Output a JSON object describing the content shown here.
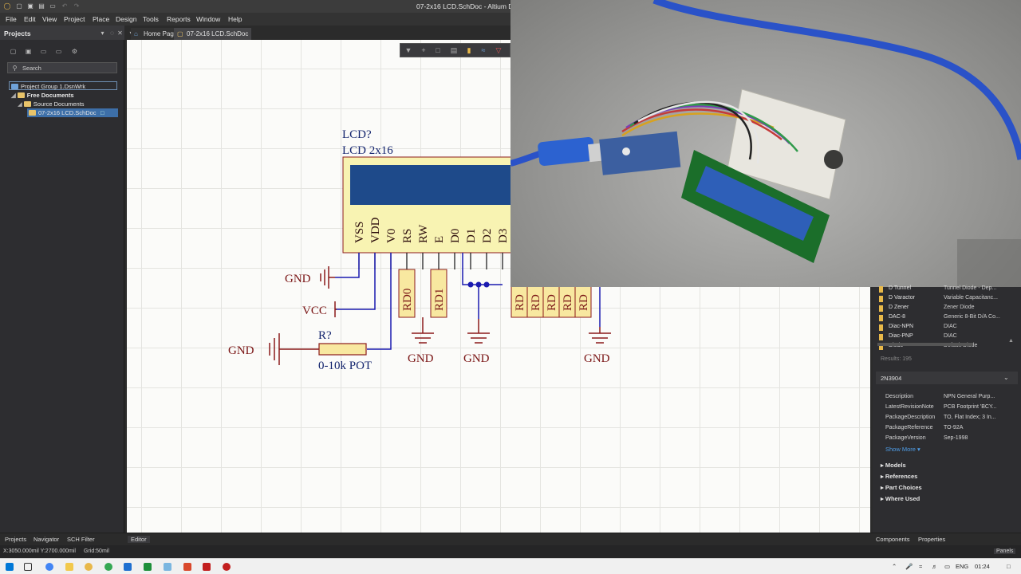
{
  "window": {
    "title": "07-2x16 LCD.SchDoc - Altium Des",
    "min_icon": "minimize-icon"
  },
  "menu": [
    "File",
    "Edit",
    "View",
    "Project",
    "Place",
    "Design",
    "Tools",
    "Reports",
    "Window",
    "Help"
  ],
  "projects_panel": {
    "title": "Projects",
    "search_placeholder": "Search",
    "tree": [
      {
        "label": "Project Group 1.DsnWrk",
        "level": 0
      },
      {
        "label": "Free Documents",
        "level": 1
      },
      {
        "label": "Source Documents",
        "level": 2
      },
      {
        "label": "07-2x16 LCD.SchDoc",
        "level": 3
      }
    ]
  },
  "tabs": [
    {
      "label": "Home Page"
    },
    {
      "label": "07-2x16 LCD.SchDoc"
    }
  ],
  "schematic": {
    "designator": "LCD?",
    "part": "LCD 2x16",
    "pins": [
      "VSS",
      "VDD",
      "V0",
      "RS",
      "RW",
      "E",
      "D0",
      "D1",
      "D2",
      "D3"
    ],
    "resistors_left": [
      "RD0",
      "RD1"
    ],
    "resistors_right": [
      "RD",
      "RD",
      "RD",
      "RD",
      "RD"
    ],
    "gnd_label": "GND",
    "vcc_label": "VCC",
    "pot_designator": "R?",
    "pot_value": "0-10k POT"
  },
  "components_list": [
    {
      "name": "D Tunnel",
      "desc": "Tunnel Diode - Dep..."
    },
    {
      "name": "D Varactor",
      "desc": "Variable Capacitanc..."
    },
    {
      "name": "D Zener",
      "desc": "Zener Diode"
    },
    {
      "name": "DAC-8",
      "desc": "Generic 8-Bit D/A Co..."
    },
    {
      "name": "Diac-NPN",
      "desc": "DIAC"
    },
    {
      "name": "Diac-PNP",
      "desc": "DIAC"
    },
    {
      "name": "Diode",
      "desc": "Default Diode"
    }
  ],
  "results": "Results: 195",
  "selected_component": {
    "name": "2N3904",
    "properties": [
      {
        "k": "Description",
        "v": "NPN General Purp..."
      },
      {
        "k": "LatestRevisionNote",
        "v": "PCB Footprint 'BCY..."
      },
      {
        "k": "PackageDescription",
        "v": "TO, Flat Index; 3 In..."
      },
      {
        "k": "PackageReference",
        "v": "TO-92A"
      },
      {
        "k": "PackageVersion",
        "v": "Sep-1998"
      }
    ],
    "show_more": "Show More ▾",
    "sections": [
      "Models",
      "References",
      "Part Choices",
      "Where Used"
    ]
  },
  "bottom_tabs": {
    "left": [
      "Projects",
      "Navigator",
      "SCH Filter"
    ],
    "editor": "Editor",
    "right": [
      "Components",
      "Properties"
    ]
  },
  "status": {
    "coords": "X:3050.000mil Y:2700.000mil",
    "grid": "Grid:50mil",
    "panels": "Panels"
  },
  "taskbar": {
    "lang": "ENG",
    "time": "01:24"
  },
  "colors": {
    "wire": "#1b1bb0",
    "part_fill": "#f8f3b2",
    "part_border": "#8b1a1a",
    "lcd_screen": "#1e4a8a",
    "resistor_fill": "#f8e8a0"
  }
}
